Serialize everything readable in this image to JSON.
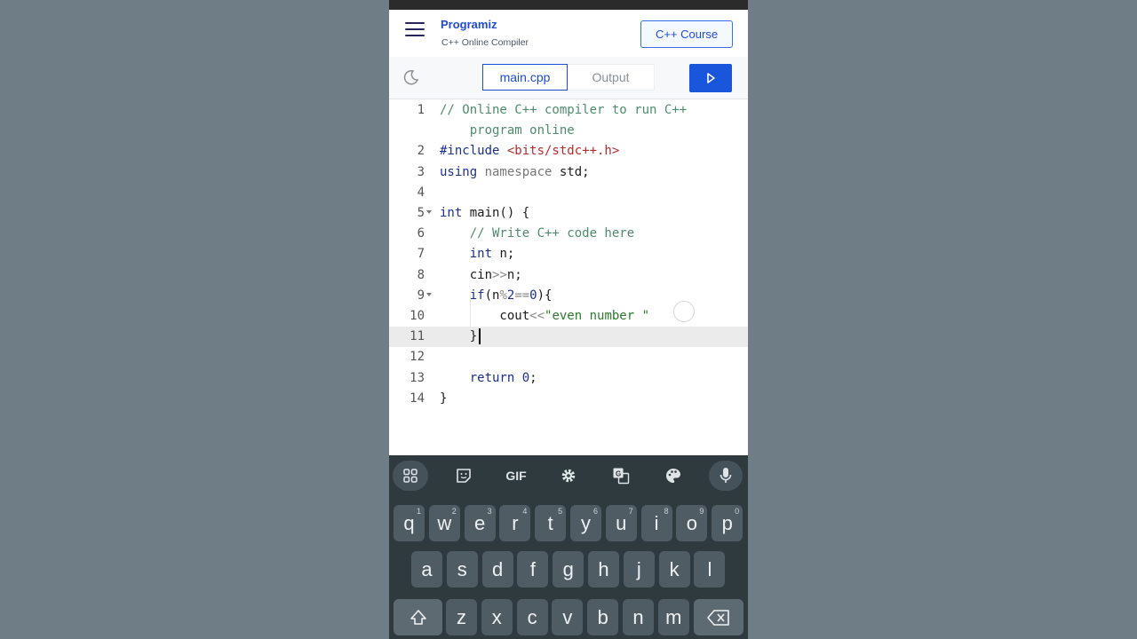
{
  "header": {
    "logo_text": "Programiz",
    "subtitle": "C++ Online Compiler",
    "course_button": "C++ Course"
  },
  "toolbar": {
    "tab_main": "main.cpp",
    "tab_output": "Output"
  },
  "editor": {
    "active_line": 11,
    "lines": [
      {
        "n": "1",
        "tokens": [
          {
            "t": "// Online C++ compiler to run C++",
            "c": "comment"
          }
        ]
      },
      {
        "n": "",
        "tokens": [
          {
            "t": "    program online",
            "c": "comment"
          }
        ]
      },
      {
        "n": "2",
        "tokens": [
          {
            "t": "#include ",
            "c": "kw"
          },
          {
            "t": "<bits/stdc++.h>",
            "c": "inc"
          }
        ]
      },
      {
        "n": "3",
        "tokens": [
          {
            "t": "using ",
            "c": "kw"
          },
          {
            "t": "namespace ",
            "c": "dim"
          },
          {
            "t": "std;",
            "c": "plain"
          }
        ]
      },
      {
        "n": "4",
        "tokens": []
      },
      {
        "n": "5",
        "fold": true,
        "tokens": [
          {
            "t": "int ",
            "c": "kw"
          },
          {
            "t": "main() {",
            "c": "plain"
          }
        ]
      },
      {
        "n": "6",
        "tokens": [
          {
            "t": "    ",
            "c": "plain"
          },
          {
            "t": "// Write C++ code here",
            "c": "comment"
          }
        ]
      },
      {
        "n": "7",
        "tokens": [
          {
            "t": "    ",
            "c": "plain"
          },
          {
            "t": "int ",
            "c": "kw"
          },
          {
            "t": "n;",
            "c": "plain"
          }
        ]
      },
      {
        "n": "8",
        "tokens": [
          {
            "t": "    cin",
            "c": "plain"
          },
          {
            "t": ">>",
            "c": "op"
          },
          {
            "t": "n;",
            "c": "plain"
          }
        ]
      },
      {
        "n": "9",
        "fold": true,
        "tokens": [
          {
            "t": "    ",
            "c": "plain"
          },
          {
            "t": "if",
            "c": "kw"
          },
          {
            "t": "(n",
            "c": "plain"
          },
          {
            "t": "%",
            "c": "op"
          },
          {
            "t": "2",
            "c": "num"
          },
          {
            "t": "==",
            "c": "op"
          },
          {
            "t": "0",
            "c": "num"
          },
          {
            "t": "){",
            "c": "plain"
          }
        ]
      },
      {
        "n": "10",
        "tokens": [
          {
            "t": "        cout",
            "c": "plain"
          },
          {
            "t": "<<",
            "c": "op"
          },
          {
            "t": "\"even number \"",
            "c": "str"
          }
        ]
      },
      {
        "n": "11",
        "tokens": [
          {
            "t": "    }",
            "c": "plain"
          }
        ]
      },
      {
        "n": "12",
        "tokens": []
      },
      {
        "n": "13",
        "tokens": [
          {
            "t": "    ",
            "c": "plain"
          },
          {
            "t": "return ",
            "c": "kw"
          },
          {
            "t": "0",
            "c": "num"
          },
          {
            "t": ";",
            "c": "plain"
          }
        ]
      },
      {
        "n": "14",
        "tokens": [
          {
            "t": "}",
            "c": "plain"
          }
        ]
      }
    ]
  },
  "keyboard": {
    "gif_label": "GIF",
    "row1": [
      {
        "k": "q",
        "s": "1"
      },
      {
        "k": "w",
        "s": "2"
      },
      {
        "k": "e",
        "s": "3"
      },
      {
        "k": "r",
        "s": "4"
      },
      {
        "k": "t",
        "s": "5"
      },
      {
        "k": "y",
        "s": "6"
      },
      {
        "k": "u",
        "s": "7"
      },
      {
        "k": "i",
        "s": "8"
      },
      {
        "k": "o",
        "s": "9"
      },
      {
        "k": "p",
        "s": "0"
      }
    ],
    "row2": [
      "a",
      "s",
      "d",
      "f",
      "g",
      "h",
      "j",
      "k",
      "l"
    ],
    "row3": [
      "z",
      "x",
      "c",
      "v",
      "b",
      "n",
      "m"
    ]
  },
  "colors": {
    "brand_blue": "#1a56db",
    "keyboard_bg": "#2f3a3f",
    "key_bg": "#505c63"
  }
}
